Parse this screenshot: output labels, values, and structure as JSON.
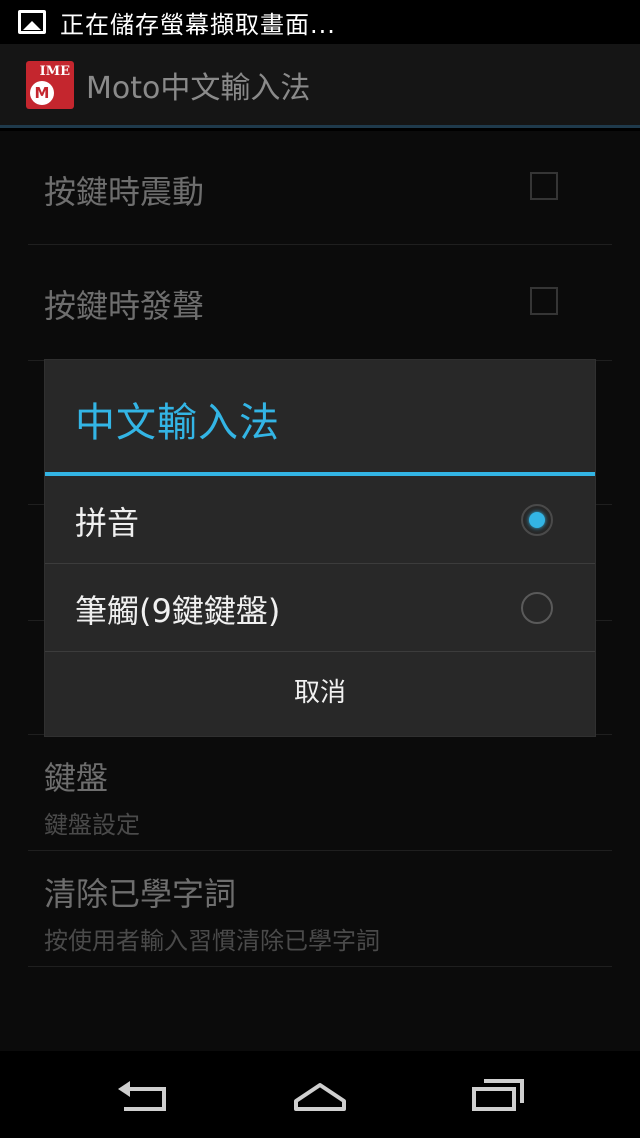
{
  "status_bar": {
    "notification_text": "正在儲存螢幕擷取畫面..."
  },
  "action_bar": {
    "app_icon_label": "IME",
    "title": "Moto中文輸入法"
  },
  "settings": [
    {
      "title": "按鍵時震動",
      "checked": false
    },
    {
      "title": "按鍵時發聲",
      "checked": false
    },
    {
      "title": "鍵盤",
      "summary": "鍵盤設定"
    },
    {
      "title": "清除已學字詞",
      "summary": "按使用者輸入習慣清除已學字詞"
    }
  ],
  "dialog": {
    "title": "中文輸入法",
    "options": [
      {
        "label": "拼音",
        "selected": true
      },
      {
        "label": "筆觸(9鍵鍵盤)",
        "selected": false
      }
    ],
    "cancel_label": "取消"
  },
  "colors": {
    "accent": "#33b5e5",
    "background": "#0b0b0b",
    "dialog": "#282828"
  },
  "navbar": {
    "icons": [
      "back-icon",
      "home-icon",
      "recent-apps-icon"
    ]
  }
}
